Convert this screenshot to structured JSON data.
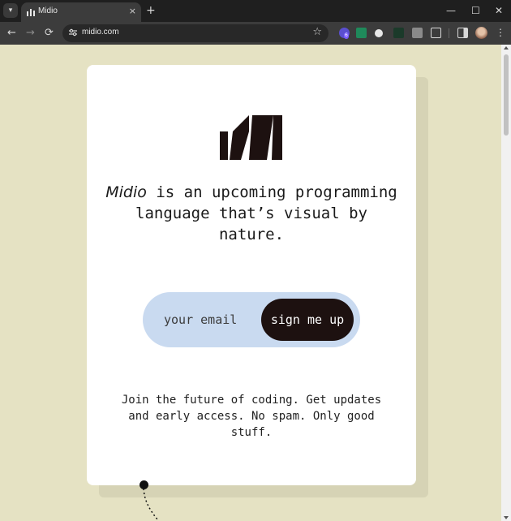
{
  "browser": {
    "tab_title": "Midio",
    "tab_close": "×",
    "new_tab": "+",
    "url": "midio.com",
    "window_controls": {
      "minimize": "—",
      "maximize": "☐",
      "close": "✕"
    },
    "extensions": [
      "extension-badge-icon",
      "s-extension-icon",
      "circle-extension-icon",
      "chart-extension-icon",
      "f-extension-icon",
      "puzzle-extensions-icon"
    ],
    "extension_badge_count": "6"
  },
  "page": {
    "brand_name": "Midio",
    "tagline_rest": " is an upcoming programming language that’s visual by nature.",
    "email_placeholder": "your email",
    "signup_label": "sign me up",
    "footnote": "Join the future of coding. Get updates and early access. No spam. Only good stuff."
  },
  "colors": {
    "background": "#e5e2c3",
    "card": "#ffffff",
    "pill": "#c9daf0",
    "button": "#1d1110",
    "logo": "#1d1110"
  }
}
